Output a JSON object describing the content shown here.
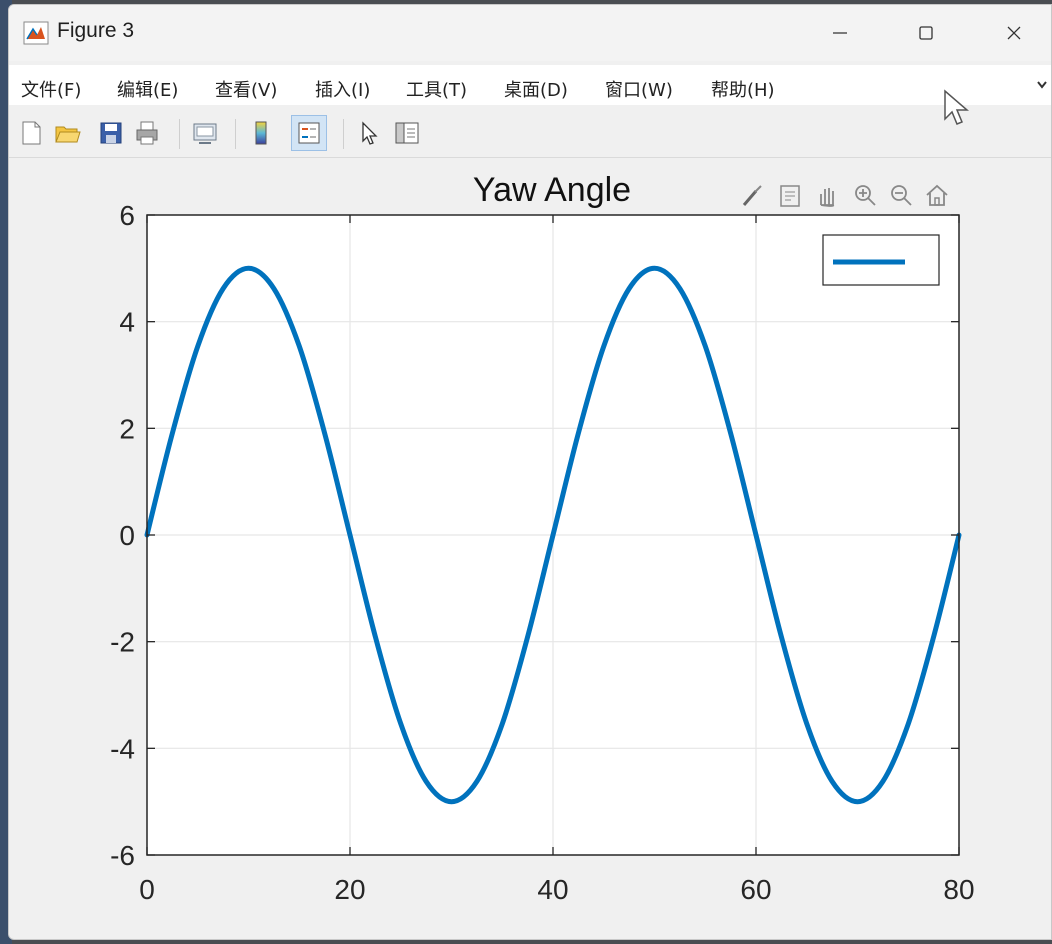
{
  "window": {
    "title": "Figure 3"
  },
  "menu": {
    "items": [
      "文件(F)",
      "编辑(E)",
      "查看(V)",
      "插入(I)",
      "工具(T)",
      "桌面(D)",
      "窗口(W)",
      "帮助(H)"
    ]
  },
  "toolbar": {
    "icons": [
      "new-figure-icon",
      "open-file-icon",
      "save-icon",
      "print-icon",
      "link-plot-icon",
      "colorbar-icon",
      "legend-icon",
      "edit-plot-icon",
      "property-inspector-icon"
    ]
  },
  "axes_toolbar": {
    "icons": [
      "brush-icon",
      "data-tips-icon",
      "pan-icon",
      "zoom-in-icon",
      "zoom-out-icon",
      "home-icon"
    ]
  },
  "colors": {
    "line": "#0072BD",
    "grid": "#e6e6e6",
    "axes_bg": "#ffffff",
    "figure_bg": "#f0f0f0"
  },
  "chart_data": {
    "type": "line",
    "title": "Yaw Angle",
    "xlabel": "",
    "ylabel": "",
    "xlim": [
      0,
      80
    ],
    "ylim": [
      -6,
      6
    ],
    "x_ticks": [
      0,
      20,
      40,
      60,
      80
    ],
    "y_ticks": [
      -6,
      -4,
      -2,
      0,
      2,
      4,
      6
    ],
    "x_tick_labels": [
      "0",
      "20",
      "40",
      "60",
      "80"
    ],
    "y_tick_labels": [
      "-6",
      "-4",
      "-2",
      "0",
      "2",
      "4",
      "6"
    ],
    "grid": true,
    "legend": {
      "placement": "top-right",
      "entries": [
        ""
      ]
    },
    "series": [
      {
        "x": [
          0,
          2.5,
          5,
          7.5,
          10,
          12.5,
          15,
          17.5,
          20,
          22.5,
          25,
          27.5,
          30,
          32.5,
          35,
          37.5,
          40,
          42.5,
          45,
          47.5,
          50,
          52.5,
          55,
          57.5,
          60,
          62.5,
          65,
          67.5,
          70,
          72.5,
          75,
          77.5,
          80
        ],
        "values": [
          0,
          1.91,
          3.54,
          4.62,
          5.0,
          4.62,
          3.54,
          1.91,
          0,
          -1.91,
          -3.54,
          -4.62,
          -5.0,
          -4.62,
          -3.54,
          -1.91,
          0,
          1.91,
          3.54,
          4.62,
          5.0,
          4.62,
          3.54,
          1.91,
          0,
          -1.91,
          -3.54,
          -4.62,
          -5.0,
          -4.62,
          -3.54,
          -1.91,
          0
        ]
      }
    ]
  }
}
